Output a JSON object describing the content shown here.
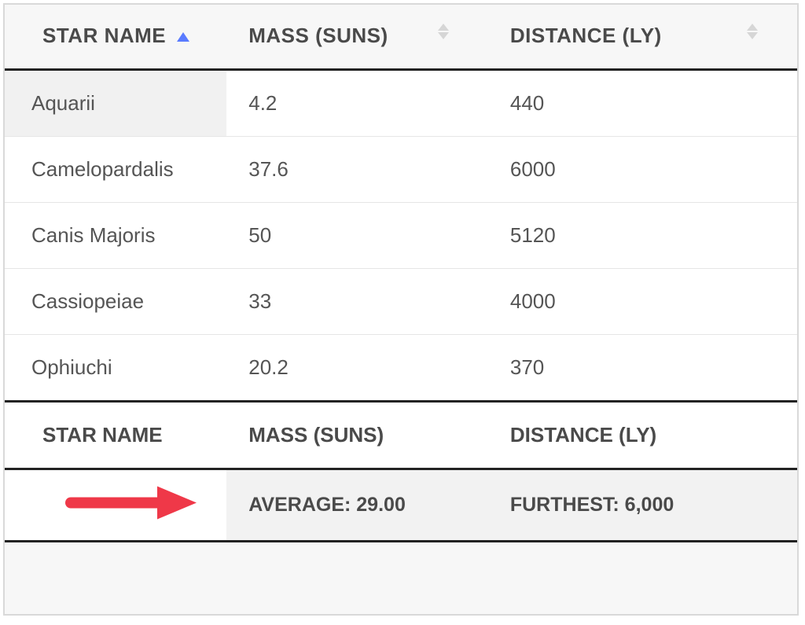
{
  "columns": [
    {
      "label": "STAR NAME",
      "sort": "asc"
    },
    {
      "label": "MASS (SUNS)",
      "sort": "both"
    },
    {
      "label": "DISTANCE (LY)",
      "sort": "both"
    }
  ],
  "rows": [
    {
      "name": "Aquarii",
      "mass": "4.2",
      "distance": "440"
    },
    {
      "name": "Camelopardalis",
      "mass": "37.6",
      "distance": "6000"
    },
    {
      "name": "Canis Majoris",
      "mass": "50",
      "distance": "5120"
    },
    {
      "name": "Cassiopeiae",
      "mass": "33",
      "distance": "4000"
    },
    {
      "name": "Ophiuchi",
      "mass": "20.2",
      "distance": "370"
    }
  ],
  "summary_header": [
    "STAR NAME",
    "MASS (SUNS)",
    "DISTANCE (LY)"
  ],
  "summary": {
    "mass": "AVERAGE: 29.00",
    "distance": "FURTHEST: 6,000"
  },
  "chart_data": {
    "type": "table",
    "columns": [
      "Star Name",
      "Mass (Suns)",
      "Distance (LY)"
    ],
    "rows": [
      [
        "Aquarii",
        4.2,
        440
      ],
      [
        "Camelopardalis",
        37.6,
        6000
      ],
      [
        "Canis Majoris",
        50,
        5120
      ],
      [
        "Cassiopeiae",
        33,
        4000
      ],
      [
        "Ophiuchi",
        20.2,
        370
      ]
    ],
    "summary": {
      "mass_average": 29.0,
      "distance_furthest": 6000
    }
  }
}
